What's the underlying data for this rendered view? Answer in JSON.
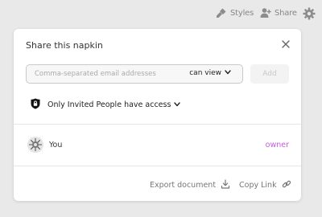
{
  "toolbar": {
    "styles_label": "Styles",
    "share_label": "Share",
    "styles_icon": "paint-brush-icon",
    "share_icon": "add-user-icon",
    "settings_icon": "gear-icon"
  },
  "dialog": {
    "title": "Share this napkin",
    "close_icon": "close-icon",
    "email": {
      "value": "",
      "placeholder": "Comma-separated email addresses",
      "permission": "can view"
    },
    "add_label": "Add",
    "access": {
      "icon": "lock-shield-icon",
      "label": "Only Invited People have access"
    },
    "members": [
      {
        "name": "You",
        "role": "owner",
        "role_color": "#c45be0"
      }
    ],
    "footer": {
      "export_label": "Export document",
      "export_icon": "download-icon",
      "copy_label": "Copy Link",
      "copy_icon": "link-icon"
    }
  }
}
